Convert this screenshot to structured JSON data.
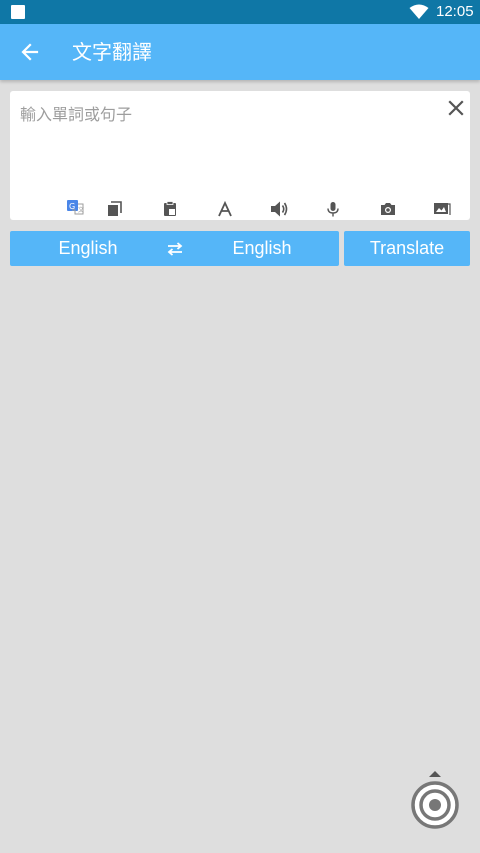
{
  "status_bar": {
    "time": "12:05",
    "icons": [
      "notification-square-icon",
      "wifi-icon"
    ]
  },
  "app_bar": {
    "title": "文字翻譯",
    "back_icon": "arrow-left-icon"
  },
  "input": {
    "placeholder": "輸入單詞或句子",
    "value": "",
    "clear_icon": "close-icon"
  },
  "toolbar": {
    "icons": [
      "google-translate-icon",
      "copy-icon",
      "paste-icon",
      "font-size-icon",
      "speaker-icon",
      "microphone-icon",
      "camera-icon",
      "image-icon"
    ]
  },
  "language": {
    "source": "English",
    "target": "English",
    "swap_icon": "swap-arrows-icon"
  },
  "translate": {
    "label": "Translate"
  },
  "colors": {
    "status_bar": "#0f77a6",
    "accent": "#55b6f8",
    "background": "#dedede",
    "card": "#ffffff"
  }
}
